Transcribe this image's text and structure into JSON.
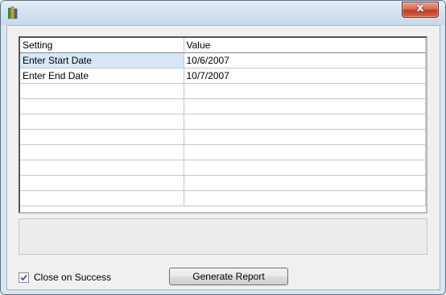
{
  "window": {
    "icon": "books-icon",
    "close_label": "x"
  },
  "grid": {
    "headers": [
      "Setting",
      "Value"
    ],
    "rows": [
      {
        "setting": "Enter Start Date",
        "value": "10/6/2007"
      },
      {
        "setting": "Enter End Date",
        "value": "10/7/2007"
      },
      {
        "setting": "",
        "value": ""
      },
      {
        "setting": "",
        "value": ""
      },
      {
        "setting": "",
        "value": ""
      },
      {
        "setting": "",
        "value": ""
      },
      {
        "setting": "",
        "value": ""
      },
      {
        "setting": "",
        "value": ""
      },
      {
        "setting": "",
        "value": ""
      },
      {
        "setting": "",
        "value": ""
      }
    ],
    "selected_cell": "Enter Start Date"
  },
  "footer": {
    "close_on_success_label": "Close on Success",
    "close_on_success_checked": true,
    "generate_label": "Generate Report"
  },
  "colors": {
    "selection": "#d6e8f8",
    "close_button": "#c23a20"
  }
}
